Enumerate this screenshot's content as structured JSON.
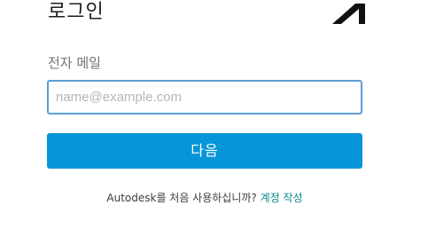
{
  "header": {
    "title": "로그인",
    "logo_icon": "autodesk-logo-icon"
  },
  "form": {
    "email_label": "전자 메일",
    "email_value": "",
    "email_placeholder": "name@example.com",
    "next_label": "다음"
  },
  "footer": {
    "prompt_text": "Autodesk를 처음 사용하십니까?",
    "create_account_link": "계정 작성"
  },
  "colors": {
    "primary_button": "#0696d7",
    "input_focus_border": "#5b9ed6",
    "link": "#0a8a8a"
  }
}
